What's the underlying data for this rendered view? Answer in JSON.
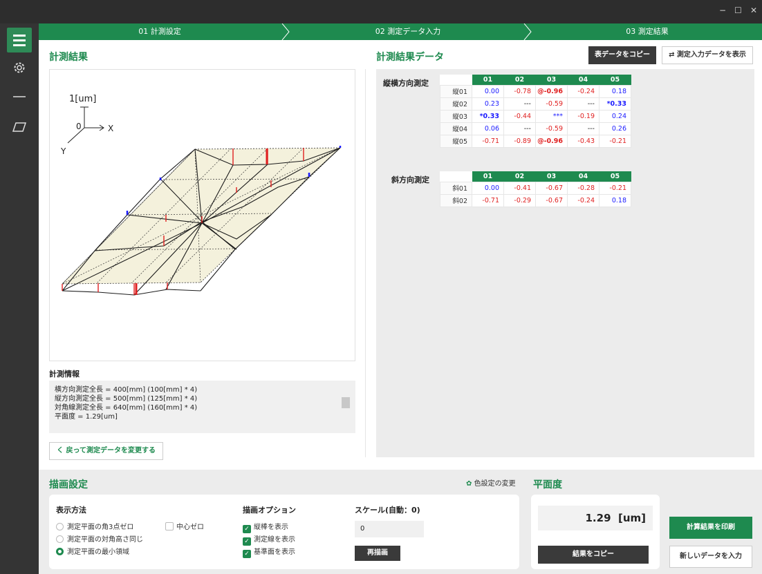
{
  "window": {
    "minimize": "−",
    "maximize": "☐",
    "close": "✕"
  },
  "steps": [
    "01 計測設定",
    "02 測定データ入力",
    "03 測定結果"
  ],
  "left": {
    "title": "計測結果",
    "axis_unit": "1[um]",
    "axis_zero": "0",
    "axis_x": "X",
    "axis_y": "Y",
    "info_label": "計測情報",
    "info_lines": [
      "横方向測定全長 = 400[mm] (100[mm] * 4)",
      "縦方向測定全長 = 500[mm] (125[mm] * 4)",
      "対角線測定全長 = 640[mm] (160[mm] * 4)",
      "平面度 = 1.29[um]"
    ],
    "back_button": "く 戻って測定データを変更する"
  },
  "right": {
    "title": "計測結果データ",
    "copy_button": "表データをコピー",
    "show_input_button": "⇄ 測定入力データを表示",
    "table1": {
      "label": "縦横方向測定",
      "columns": [
        "01",
        "02",
        "03",
        "04",
        "05"
      ],
      "rows": [
        {
          "head": "縦01",
          "cells": [
            "0.00",
            "-0.78",
            "@-0.96",
            "-0.24",
            "0.18"
          ]
        },
        {
          "head": "縦02",
          "cells": [
            "0.23",
            "---",
            "-0.59",
            "---",
            "*0.33"
          ]
        },
        {
          "head": "縦03",
          "cells": [
            "*0.33",
            "-0.44",
            "***",
            "-0.19",
            "0.24"
          ]
        },
        {
          "head": "縦04",
          "cells": [
            "0.06",
            "---",
            "-0.59",
            "---",
            "0.26"
          ]
        },
        {
          "head": "縦05",
          "cells": [
            "-0.71",
            "-0.89",
            "@-0.96",
            "-0.43",
            "-0.21"
          ]
        }
      ]
    },
    "table2": {
      "label": "斜方向測定",
      "columns": [
        "01",
        "02",
        "03",
        "04",
        "05"
      ],
      "rows": [
        {
          "head": "斜01",
          "cells": [
            "0.00",
            "-0.41",
            "-0.67",
            "-0.28",
            "-0.21"
          ]
        },
        {
          "head": "斜02",
          "cells": [
            "-0.71",
            "-0.29",
            "-0.67",
            "-0.24",
            "0.18"
          ]
        }
      ]
    }
  },
  "draw_settings": {
    "title": "描画設定",
    "color_change": "色設定の変更",
    "display_method_label": "表示方法",
    "radios": [
      "測定平面の角3点ゼロ",
      "測定平面の対角高さ同じ",
      "測定平面の最小領域"
    ],
    "center_zero": "中心ゼロ",
    "options_label": "描画オプション",
    "options": [
      "縦棒を表示",
      "測定線を表示",
      "基準面を表示"
    ],
    "scale_label": "スケール(自動：0)",
    "scale_value": "0",
    "redraw_button": "再描画"
  },
  "flatness": {
    "title": "平面度",
    "value": "1.29",
    "unit": "[um]",
    "copy_button": "結果をコピー",
    "print_button": "計算結果を印刷",
    "new_button": "新しいデータを入力"
  },
  "colors": {
    "accent": "#1e8a4f",
    "positive": "#1a1aff",
    "negative": "#e02020"
  }
}
